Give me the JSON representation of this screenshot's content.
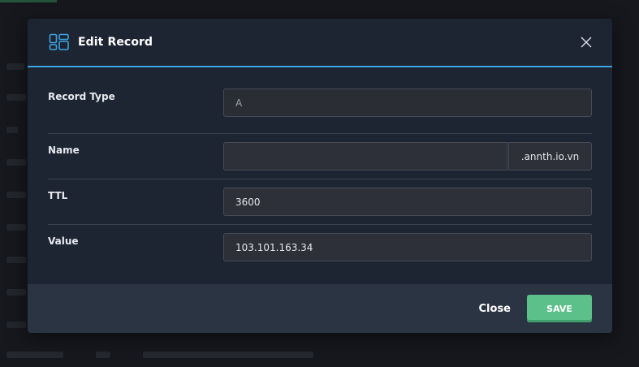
{
  "modal": {
    "title": "Edit Record",
    "icon": "layout-icon",
    "accent_color": "#3aa3e3"
  },
  "form": {
    "record_type": {
      "label": "Record Type",
      "value": "A"
    },
    "name": {
      "label": "Name",
      "value": "",
      "suffix": ".annth.io.vn"
    },
    "ttl": {
      "label": "TTL",
      "value": "3600"
    },
    "value": {
      "label": "Value",
      "value": "103.101.163.34"
    }
  },
  "footer": {
    "close_label": "Close",
    "save_label": "SAVE",
    "save_color": "#5cc08a"
  }
}
